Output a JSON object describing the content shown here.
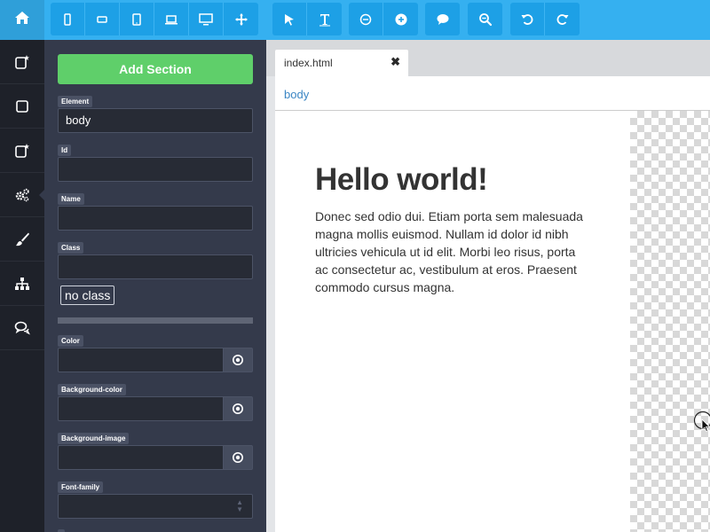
{
  "toolbar": {
    "home_icon": "home-icon",
    "groups": [
      {
        "name": "devices",
        "items": [
          "mobile-portrait-icon",
          "mobile-landscape-icon",
          "tablet-icon",
          "laptop-icon",
          "desktop-icon",
          "move-icon"
        ]
      },
      {
        "name": "tools",
        "items": [
          "pointer-icon",
          "text-icon"
        ]
      },
      {
        "name": "zoom",
        "items": [
          "minus-icon",
          "plus-icon"
        ]
      },
      {
        "name": "comments",
        "items": [
          "comment-icon"
        ]
      },
      {
        "name": "view",
        "items": [
          "zoom-out-icon"
        ]
      },
      {
        "name": "history",
        "items": [
          "undo-icon",
          "redo-icon"
        ]
      }
    ]
  },
  "iconbar": {
    "items": [
      "add-element-icon",
      "box-icon",
      "add-element-alt-icon",
      "settings-icon",
      "brush-icon",
      "sitemap-icon",
      "chat-icon"
    ],
    "active_index": 3
  },
  "panel": {
    "add_section_label": "Add Section",
    "element_label": "Element",
    "element_value": "body",
    "id_label": "Id",
    "id_value": "",
    "name_label": "Name",
    "name_value": "",
    "class_label": "Class",
    "class_value": "",
    "class_chip": "no class",
    "color_label": "Color",
    "color_value": "",
    "bg_color_label": "Background-color",
    "bg_color_value": "",
    "bg_image_label": "Background-image",
    "bg_image_value": "",
    "font_family_label": "Font-family",
    "font_family_value": ""
  },
  "editor": {
    "tab_title": "index.html",
    "tab_close": "✖",
    "breadcrumb": "body"
  },
  "canvas": {
    "heading": "Hello world!",
    "paragraph": "Donec sed odio dui. Etiam porta sem malesuada magna mollis euismod. Nullam id dolor id nibh ultricies vehicula ut id elit. Morbi leo risus, porta ac consectetur ac, vestibulum at eros. Praesent commodo cursus magna."
  },
  "colors": {
    "toolbar": "#35b0f0",
    "toolbar_button": "#1da0e6",
    "panel": "#343a4b",
    "iconbar": "#1e2129",
    "accent_green": "#5fcf6a",
    "link_blue": "#3b86c4"
  }
}
